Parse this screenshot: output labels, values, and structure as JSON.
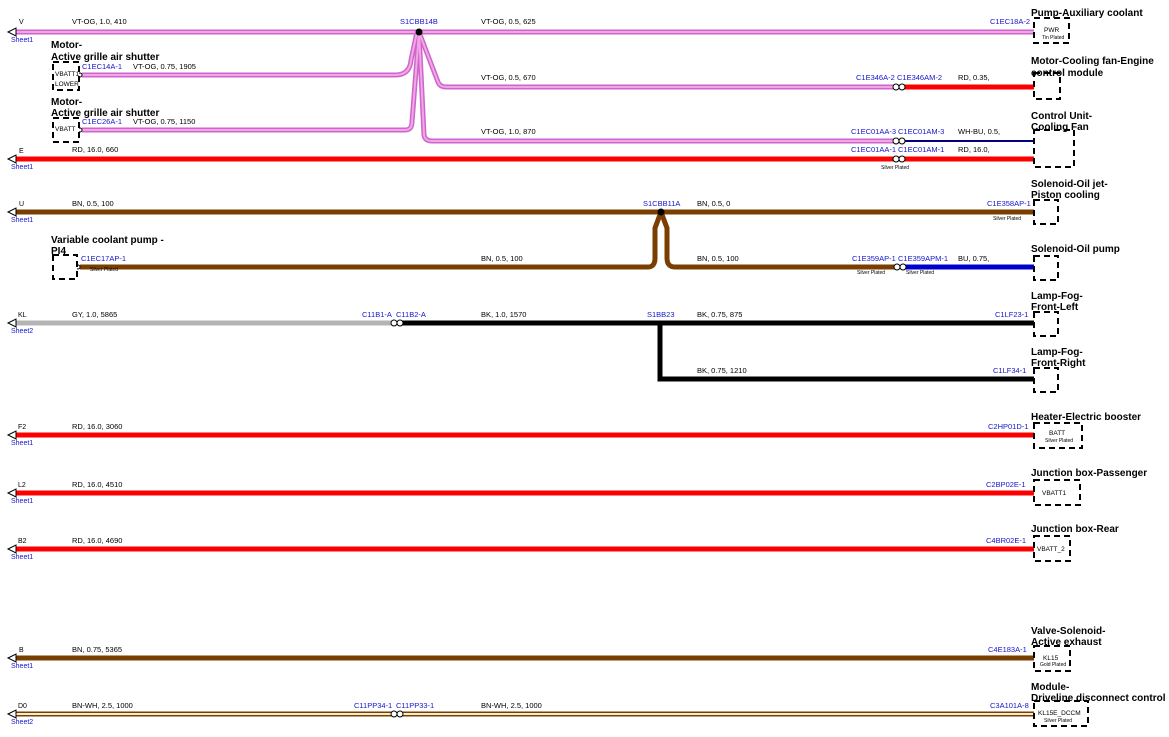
{
  "colors": {
    "violet_orange": "#cc66cc",
    "violet_orange_core": "#f3a6e6",
    "red": "#ff0000",
    "brown": "#7a3e00",
    "black": "#000000",
    "grey": "#b4b4b4",
    "blue": "#0000cc",
    "navy": "#000080",
    "brown_white": "#7a3e00",
    "brown_white_core": "#f6efce",
    "link_text": "#1515cc"
  },
  "sheet_refs": [
    {
      "net": "V",
      "sheet": "Sheet1"
    },
    {
      "net": "E",
      "sheet": "Sheet1"
    },
    {
      "net": "U",
      "sheet": "Sheet1"
    },
    {
      "net": "KL",
      "sheet": "Sheet2"
    },
    {
      "net": "F2",
      "sheet": "Sheet1"
    },
    {
      "net": "L2",
      "sheet": "Sheet1"
    },
    {
      "net": "B2",
      "sheet": "Sheet1"
    },
    {
      "net": "B",
      "sheet": "Sheet1"
    },
    {
      "net": "D0",
      "sheet": "Sheet2"
    }
  ],
  "splices": [
    "S1CBB14B",
    "S1CBB11A",
    "S1BB23"
  ],
  "wire_labels": [
    "VT-OG, 1.0, 410",
    "VT-OG, 0.5, 625",
    "VT-OG, 0.75, 1905",
    "VT-OG, 0.5, 670",
    "RD, 0.35,",
    "VT-OG, 0.75, 1150",
    "VT-OG, 1.0, 870",
    "WH-BU, 0.5,",
    "RD, 16.0, 660",
    "RD, 16.0,",
    "BN, 0.5, 100",
    "BN, 0.5, 0",
    "BN, 0.5, 100",
    "BN, 0.5, 100",
    "BU, 0.75,",
    "GY, 1.0, 5865",
    "BK, 1.0, 1570",
    "BK, 0.75, 875",
    "BK, 0.75, 1210",
    "RD, 16.0, 3060",
    "RD, 16.0, 4510",
    "RD, 16.0, 4690",
    "BN, 0.75, 5365",
    "BN-WH, 2.5, 1000",
    "BN-WH, 2.5, 1000"
  ],
  "connector_labels": [
    "C1EC18A-2",
    "C1EC14A-1",
    "C1EC26A-1",
    "C1E346A-2",
    "C1E346AM-2",
    "C1EC01AA-3",
    "C1EC01AM-3",
    "C1EC01AA-1",
    "C1EC01AM-1",
    "C1E358AP-1",
    "C1EC17AP-1",
    "C1E359AP-1",
    "C1E359APM-1",
    "C11B1-A",
    "C11B2-A",
    "C1LF23-1",
    "C1LF34-1",
    "C2HP01D-1",
    "C2BP02E-1",
    "C4BR02E-1",
    "C4E183A-1",
    "C11PP34-1",
    "C11PP33-1",
    "C3A101A-8"
  ],
  "plating_labels": [
    "Silver Plated",
    "Silver Plated",
    "Silver Plated",
    "Silver Plated",
    "Silver Plated"
  ],
  "components": [
    {
      "name": "Pump-Auxiliary coolant",
      "pin": "PWR",
      "plating": "Tin Plated"
    },
    {
      "name": "Motor-Cooling fan-Engine control module",
      "pin": "",
      "plating": ""
    },
    {
      "name": "Control Unit-Cooling Fan",
      "pin": "",
      "plating": ""
    },
    {
      "name": "Solenoid-Oil jet-Piston cooling",
      "pin": "",
      "plating": ""
    },
    {
      "name": "Solenoid-Oil pump",
      "pin": "",
      "plating": ""
    },
    {
      "name": "Lamp-Fog-Front-Left",
      "pin": "",
      "plating": ""
    },
    {
      "name": "Lamp-Fog-Front-Right",
      "pin": "",
      "plating": ""
    },
    {
      "name": "Heater-Electric booster",
      "pin": "BATT",
      "plating": "Silver Plated"
    },
    {
      "name": "Junction box-Passenger",
      "pin": "VBATT1",
      "plating": ""
    },
    {
      "name": "Junction box-Rear",
      "pin": "VBATT_2",
      "plating": ""
    },
    {
      "name": "Valve-Solenoid-Active exhaust",
      "pin": "KL15",
      "plating": "Gold Plated"
    },
    {
      "name": "Module-Driveline disconnect control",
      "pin": "KL15E_DCCM",
      "plating": "Silver Plated"
    }
  ],
  "left_components": [
    {
      "name": "Motor-Active grille air shutter",
      "pins": [
        "VBATT1",
        "LOWER"
      ]
    },
    {
      "name": "Motor-Active grille air shutter",
      "pins": [
        "VBATT"
      ]
    },
    {
      "name": "Variable coolant pump - PI4",
      "pins": []
    }
  ]
}
